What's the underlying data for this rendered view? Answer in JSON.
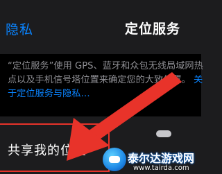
{
  "navbar": {
    "back_label": "隐私",
    "title": "定位服务"
  },
  "description": {
    "line_text": "“定位服务”使用 GPS、蓝牙和众包无线局域网热点以及手机信号塔位置来确定您的大致位置。",
    "link_text": "关于定位服务与隐私…"
  },
  "share_row": {
    "label": "共享我的位置"
  },
  "watermark": {
    "name": "泰尔达游戏网",
    "url": "www.tairda.com"
  },
  "colors": {
    "accent": "#0a84ff",
    "highlight": "#e8332a",
    "background": "#1c1c1e"
  }
}
